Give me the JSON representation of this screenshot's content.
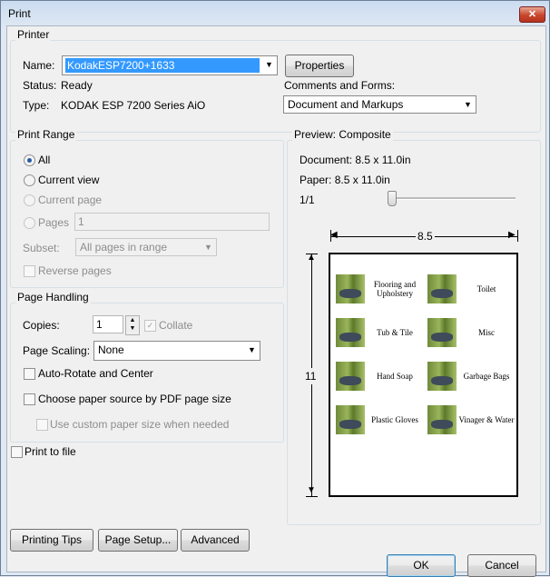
{
  "window": {
    "title": "Print"
  },
  "printer": {
    "group_label": "Printer",
    "name_label": "Name:",
    "name_value": "KodakESP7200+1633",
    "properties_button": "Properties",
    "status_label": "Status:",
    "status_value": "Ready",
    "type_label": "Type:",
    "type_value": "KODAK ESP 7200 Series AiO",
    "comments_label": "Comments and Forms:",
    "comments_value": "Document and Markups"
  },
  "print_range": {
    "group_label": "Print Range",
    "all": "All",
    "current_view": "Current view",
    "current_page": "Current page",
    "pages": "Pages",
    "pages_value": "1",
    "subset_label": "Subset:",
    "subset_value": "All pages in range",
    "reverse_pages": "Reverse pages"
  },
  "page_handling": {
    "group_label": "Page Handling",
    "copies_label": "Copies:",
    "copies_value": "1",
    "collate": "Collate",
    "scaling_label": "Page Scaling:",
    "scaling_value": "None",
    "auto_rotate": "Auto-Rotate and Center",
    "paper_source": "Choose paper source by PDF page size",
    "custom_paper": "Use custom paper size when needed"
  },
  "print_to_file": "Print to file",
  "preview": {
    "group_label": "Preview: Composite",
    "document": "Document: 8.5 x 11.0in",
    "paper": "Paper: 8.5 x 11.0in",
    "page_counter": "1/1",
    "width_dim": "8.5",
    "height_dim": "11",
    "page_progress": 0,
    "items": [
      "Flooring and Upholstery",
      "Toilet",
      "Tub & Tile",
      "Misc",
      "Hand Soap",
      "Garbage Bags",
      "Plastic Gloves",
      "Vinager & Water"
    ]
  },
  "buttons": {
    "printing_tips": "Printing Tips",
    "page_setup": "Page Setup...",
    "advanced": "Advanced",
    "ok": "OK",
    "cancel": "Cancel"
  }
}
